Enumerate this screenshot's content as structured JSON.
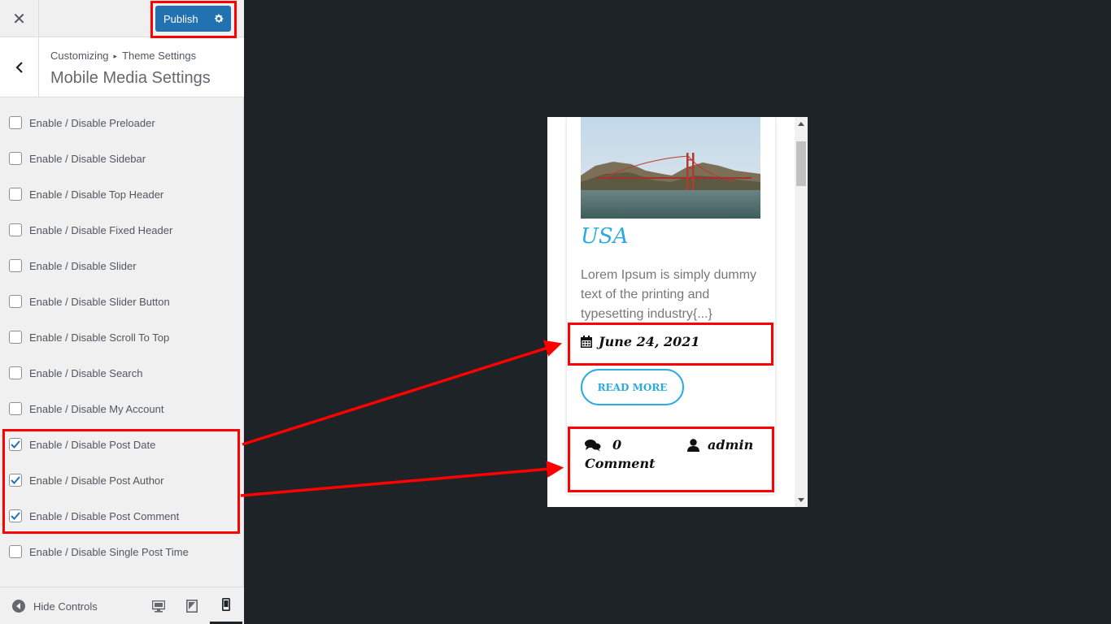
{
  "topbar": {
    "close_glyph": "✕",
    "publish_label": "Publish"
  },
  "section": {
    "breadcrumb_root": "Customizing",
    "breadcrumb_sep": "▸",
    "breadcrumb_parent": "Theme Settings",
    "title": "Mobile Media Settings"
  },
  "options": [
    {
      "label": "Enable / Disable Preloader",
      "checked": false
    },
    {
      "label": "Enable / Disable Sidebar",
      "checked": false
    },
    {
      "label": "Enable / Disable Top Header",
      "checked": false
    },
    {
      "label": "Enable / Disable Fixed Header",
      "checked": false
    },
    {
      "label": "Enable / Disable Slider",
      "checked": false
    },
    {
      "label": "Enable / Disable Slider Button",
      "checked": false
    },
    {
      "label": "Enable / Disable Scroll To Top",
      "checked": false
    },
    {
      "label": "Enable / Disable Search",
      "checked": false
    },
    {
      "label": "Enable / Disable My Account",
      "checked": false
    },
    {
      "label": "Enable / Disable Post Date",
      "checked": true
    },
    {
      "label": "Enable / Disable Post Author",
      "checked": true
    },
    {
      "label": "Enable / Disable Post Comment",
      "checked": true
    },
    {
      "label": "Enable / Disable Single Post Time",
      "checked": false
    }
  ],
  "footer": {
    "hide_controls_label": "Hide Controls",
    "active_device": "mobile"
  },
  "preview": {
    "post_title": "USA",
    "excerpt": "Lorem Ipsum is simply dummy text of the printing and typesetting industry{...}",
    "date": "June 24, 2021",
    "read_more": "READ MORE",
    "comment_count": "0",
    "comment_word": "Comment",
    "author": "admin"
  },
  "colors": {
    "publish": "#2271b1",
    "accent": "#29abe2",
    "annotation": "#ff0000",
    "backdrop": "#1d2327"
  },
  "icons": [
    "close-icon",
    "gear-icon",
    "back-chevron-icon",
    "checkmark-icon",
    "hide-controls-icon",
    "desktop-icon",
    "tablet-icon",
    "mobile-icon",
    "calendar-icon",
    "comments-icon",
    "user-icon"
  ]
}
